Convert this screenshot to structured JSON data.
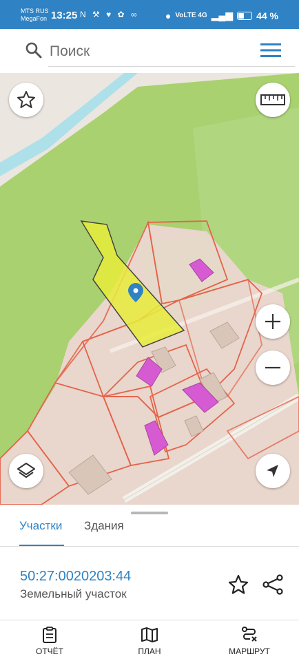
{
  "status_bar": {
    "carrier_1": "MTS RUS",
    "carrier_2": "MegaFon",
    "time": "13:25",
    "icons": "N ⚒ ♥ ✿ ∞",
    "network": "VoLTE 4G",
    "battery": "44 %"
  },
  "search": {
    "placeholder": "Поиск"
  },
  "map": {
    "colors": {
      "forest": "#a9d170",
      "land": "#e9d6cc",
      "parcel_border": "#e4634a",
      "selected_parcel": "#e8ec3a",
      "building": "#d65bd2",
      "river": "#aee0ea",
      "marker": "#2f82c3"
    }
  },
  "sheet": {
    "tabs": [
      "Участки",
      "Здания"
    ],
    "cadastral_number": "50:27:0020203:44",
    "property_type": "Земельный участок"
  },
  "bottom_nav": {
    "report": "ОТЧЁТ",
    "plan": "ПЛАН",
    "route": "МАРШРУТ"
  }
}
